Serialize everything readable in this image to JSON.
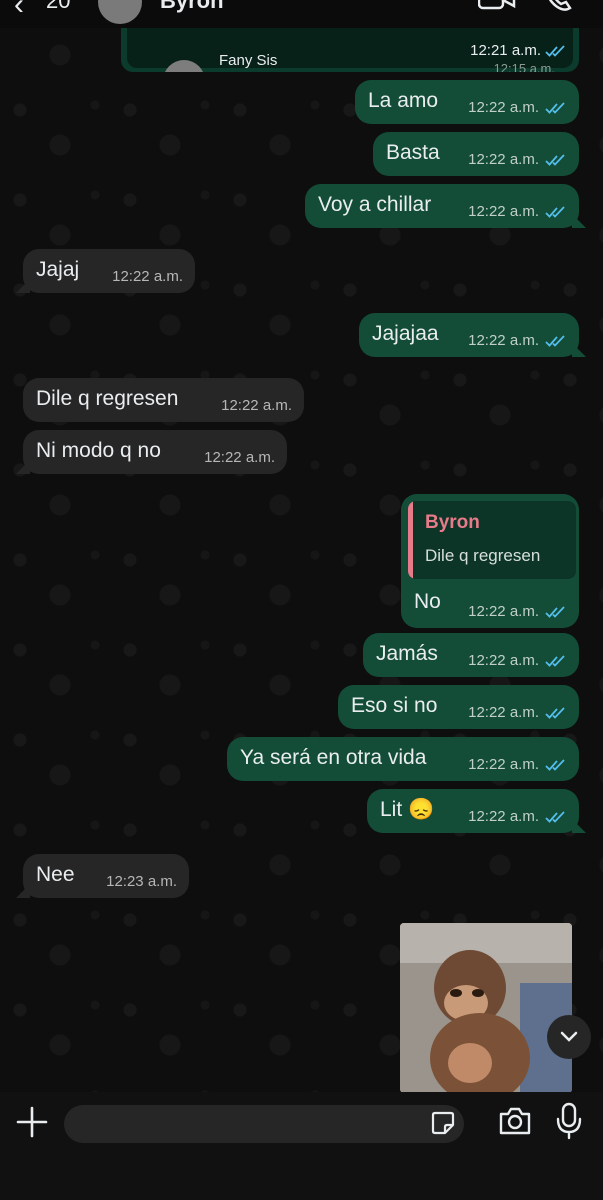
{
  "header": {
    "back_count": "20",
    "contact_name": "Byron"
  },
  "contacts_card": {
    "second_contact_name": "Fany Sis",
    "time": "12:21 a.m.",
    "second_time": "12:15 a.m."
  },
  "messages": [
    {
      "dir": "out",
      "text": "La amo",
      "time": "12:22 a.m."
    },
    {
      "dir": "out",
      "text": "Basta",
      "time": "12:22 a.m."
    },
    {
      "dir": "out",
      "text": "Voy a chillar",
      "time": "12:22 a.m."
    },
    {
      "dir": "in",
      "text": "Jajaj",
      "time": "12:22 a.m."
    },
    {
      "dir": "out",
      "text": "Jajajaa",
      "time": "12:22 a.m."
    },
    {
      "dir": "in",
      "text": "Dile q regresen",
      "time": "12:22 a.m."
    },
    {
      "dir": "in",
      "text": "Ni modo q no",
      "time": "12:22 a.m."
    },
    {
      "dir": "out",
      "text": "No",
      "time": "12:22 a.m.",
      "reply_to": {
        "name": "Byron",
        "text": "Dile q regresen"
      }
    },
    {
      "dir": "out",
      "text": "Jamás",
      "time": "12:22 a.m."
    },
    {
      "dir": "out",
      "text": "Eso si no",
      "time": "12:22 a.m."
    },
    {
      "dir": "out",
      "text": "Ya será en otra vida",
      "time": "12:22 a.m."
    },
    {
      "dir": "out",
      "text": "Lit 😞",
      "time": "12:22 a.m."
    },
    {
      "dir": "in",
      "text": "Nee",
      "time": "12:23 a.m."
    }
  ],
  "media": {
    "icon": "image-thumbnail"
  },
  "composer": {
    "placeholder": ""
  },
  "colors": {
    "outgoing_bubble": "#134d37",
    "incoming_bubble": "#262626",
    "read_ticks": "#53bdeb",
    "reply_accent": "#e77b89"
  }
}
